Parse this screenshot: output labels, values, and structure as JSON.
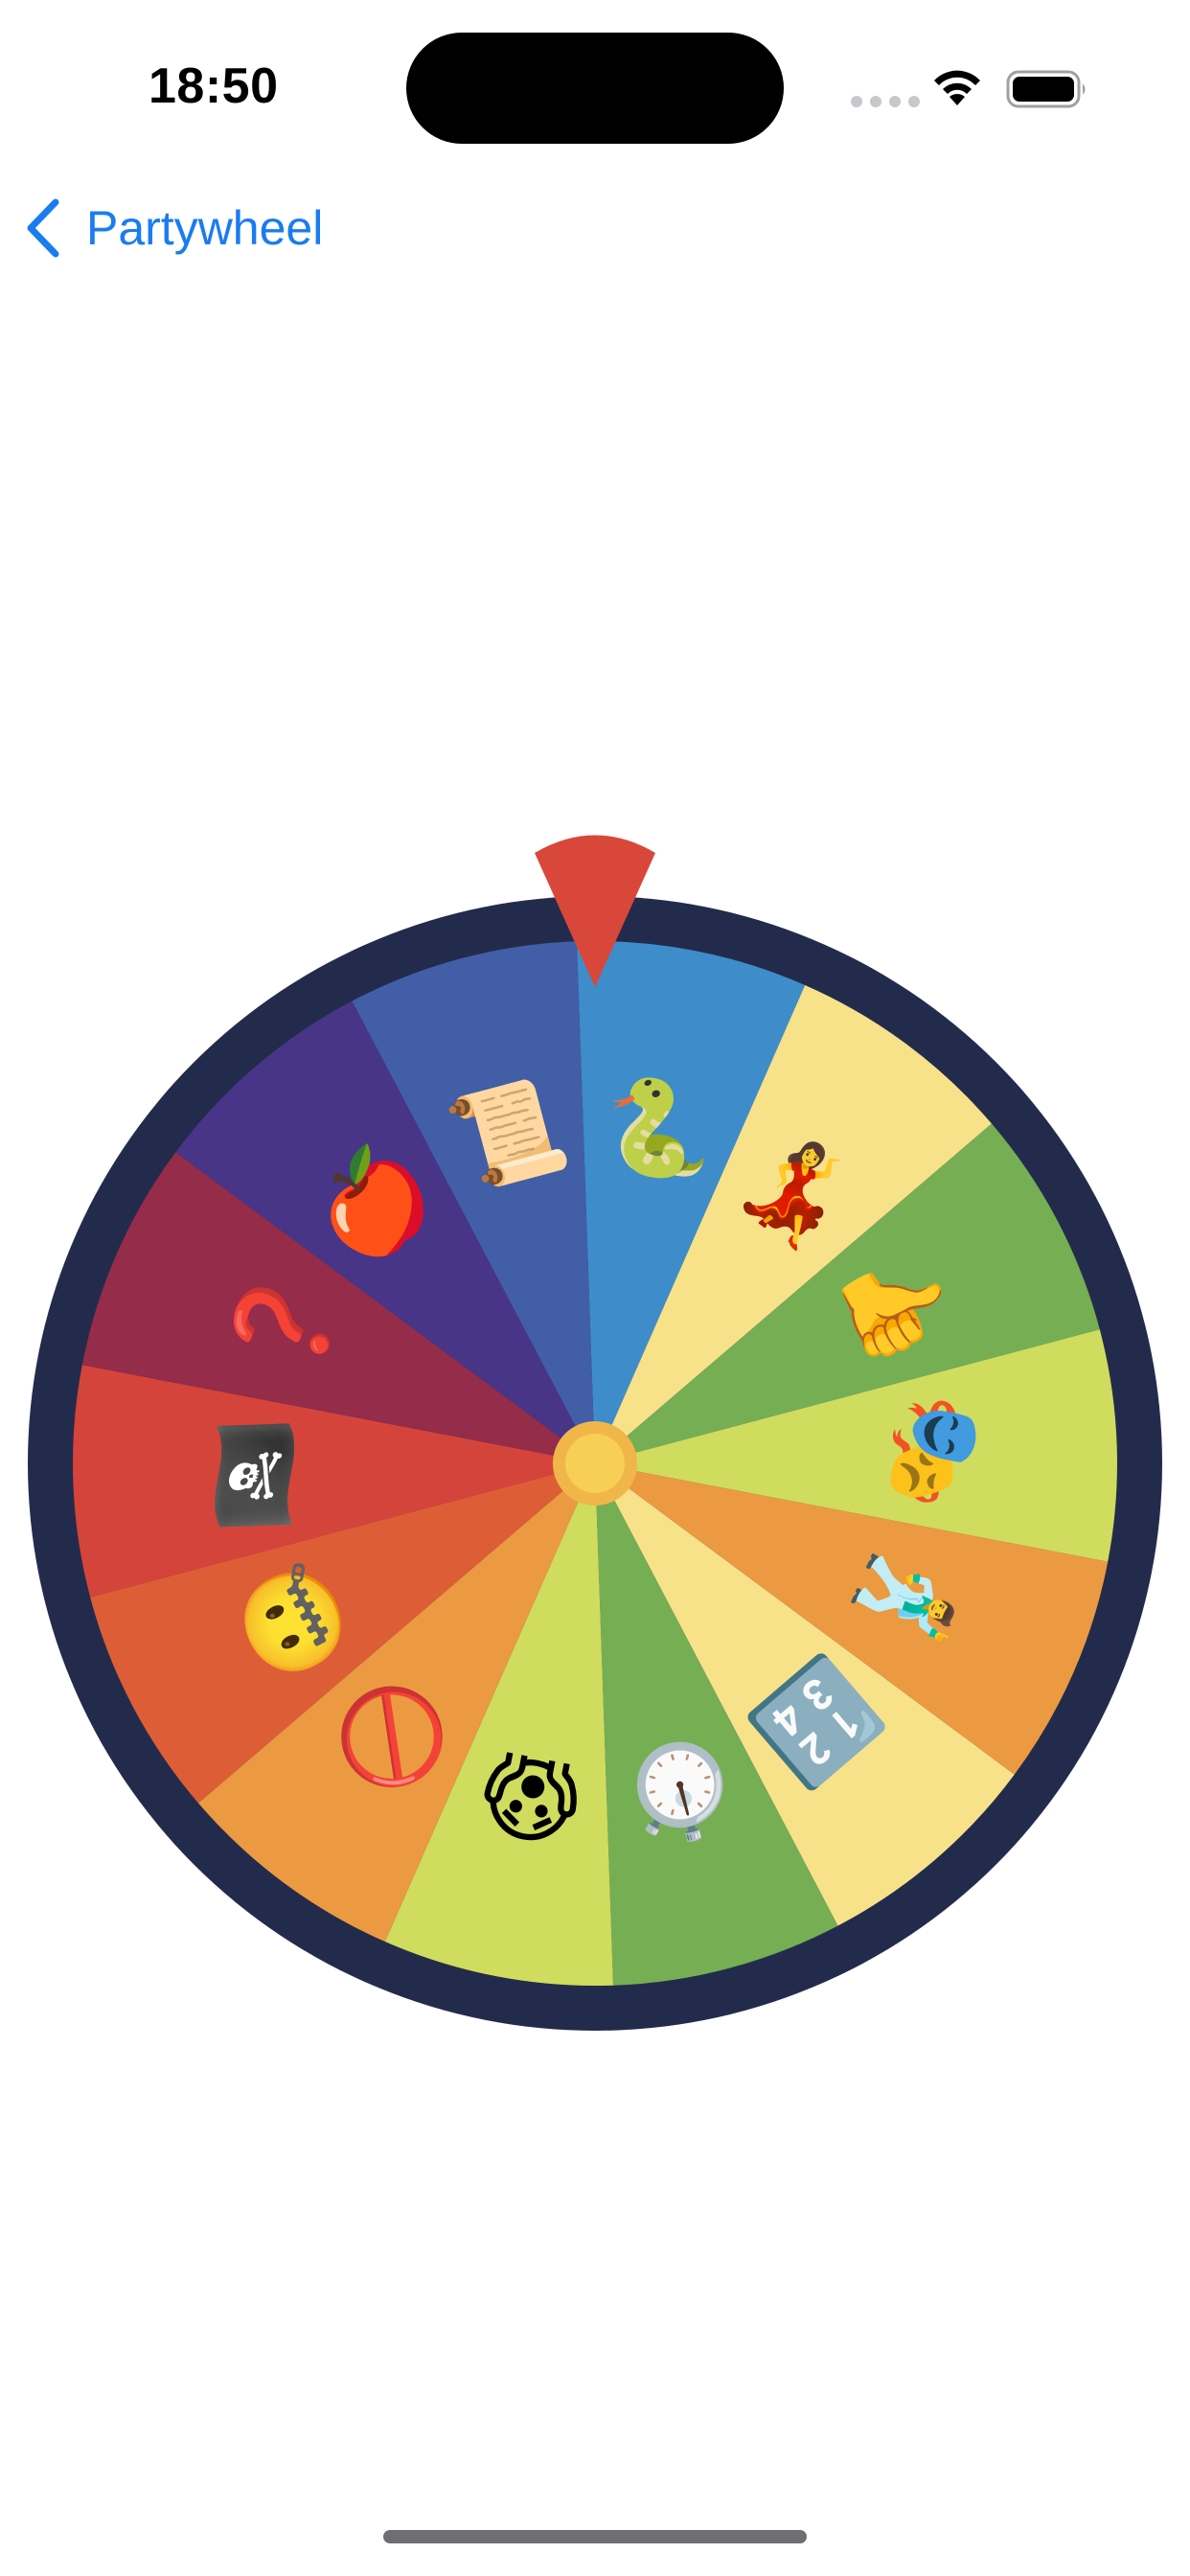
{
  "status_bar": {
    "time": "18:50",
    "icons": [
      "signal-dots-icon",
      "wifi-icon",
      "battery-icon"
    ]
  },
  "nav": {
    "back_icon": "chevron-left-icon",
    "back_label": "Partywheel",
    "accent_color": "#1a7cf1"
  },
  "wheel": {
    "rim_color": "#232b4d",
    "hub_color": "#f6c94e",
    "pointer_color": "#d9473a",
    "pointer_icon": "pointer-icon",
    "segments": [
      {
        "color": "#3e8dca",
        "emoji": "🐍",
        "icon": "snake-icon"
      },
      {
        "color": "#f7e28a",
        "emoji": "💃",
        "icon": "dancer-icon"
      },
      {
        "color": "#76ae54",
        "emoji": "👍",
        "icon": "thumbs-up-icon"
      },
      {
        "color": "#cfdc5d",
        "emoji": "🎭",
        "icon": "theater-masks-icon"
      },
      {
        "color": "#eb9a41",
        "emoji": "🕺",
        "icon": "man-dancing-icon"
      },
      {
        "color": "#f7e28a",
        "emoji": "🔢",
        "icon": "numbers-icon"
      },
      {
        "color": "#76ae54",
        "emoji": "⏱️",
        "icon": "stopwatch-icon"
      },
      {
        "color": "#cfdc5d",
        "emoji": "😱",
        "icon": "screaming-face-icon"
      },
      {
        "color": "#eb9a41",
        "emoji": "🚫",
        "icon": "prohibited-icon"
      },
      {
        "color": "#dd5e36",
        "emoji": "🤐",
        "icon": "zipper-mouth-icon"
      },
      {
        "color": "#d5443a",
        "emoji": "🏴‍☠️",
        "icon": "pirate-flag-icon"
      },
      {
        "color": "#942c4a",
        "emoji": "❓",
        "icon": "question-mark-icon"
      },
      {
        "color": "#483587",
        "emoji": "🍎",
        "icon": "apple-icon"
      },
      {
        "color": "#425ea7",
        "emoji": "📜",
        "icon": "scroll-icon"
      }
    ]
  }
}
